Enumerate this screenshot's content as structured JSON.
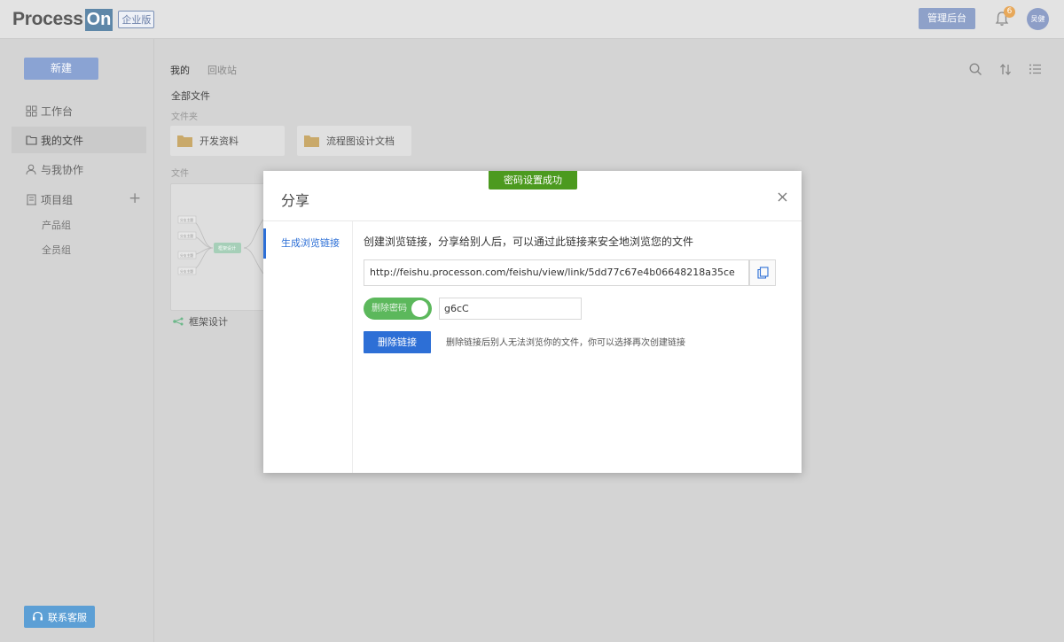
{
  "header": {
    "logo_text": "Process",
    "logo_on": "On",
    "edition": "企业版",
    "admin_label": "管理后台",
    "notification_count": "6",
    "avatar_text": "吴健"
  },
  "sidebar": {
    "new_label": "新建",
    "items": [
      {
        "label": "工作台"
      },
      {
        "label": "我的文件"
      },
      {
        "label": "与我协作"
      },
      {
        "label": "项目组"
      }
    ],
    "groups": [
      {
        "label": "产品组"
      },
      {
        "label": "全员组"
      }
    ],
    "service_label": "联系客服"
  },
  "main": {
    "tabs": [
      {
        "label": "我的"
      },
      {
        "label": "回收站"
      }
    ],
    "all_files": "全部文件",
    "folders_label": "文件夹",
    "folders": [
      {
        "name": "开发资料"
      },
      {
        "name": "流程图设计文档"
      }
    ],
    "files_label": "文件",
    "files": [
      {
        "name": "框架设计",
        "thumb_center": "框架设计",
        "thumb_nodes": [
          "分支主题",
          "分支主题",
          "分支主题",
          "分支主题"
        ]
      }
    ]
  },
  "modal": {
    "title": "分享",
    "nav_label": "生成浏览链接",
    "description": "创建浏览链接，分享给别人后，可以通过此链接来安全地浏览您的文件",
    "link_url": "http://feishu.processon.com/feishu/view/link/5dd77c67e4b06648218a35ce",
    "toggle_label": "删除密码",
    "password": "g6cC",
    "delete_label": "删除链接",
    "delete_note": "删除链接后别人无法浏览你的文件，你可以选择再次创建链接"
  },
  "toast": {
    "message": "密码设置成功"
  },
  "colors": {
    "accent": "#2d6fd6",
    "toggle_on": "#5cb85c",
    "toast_bg": "#4c9a1f",
    "overlay": "#d4d4d4"
  }
}
